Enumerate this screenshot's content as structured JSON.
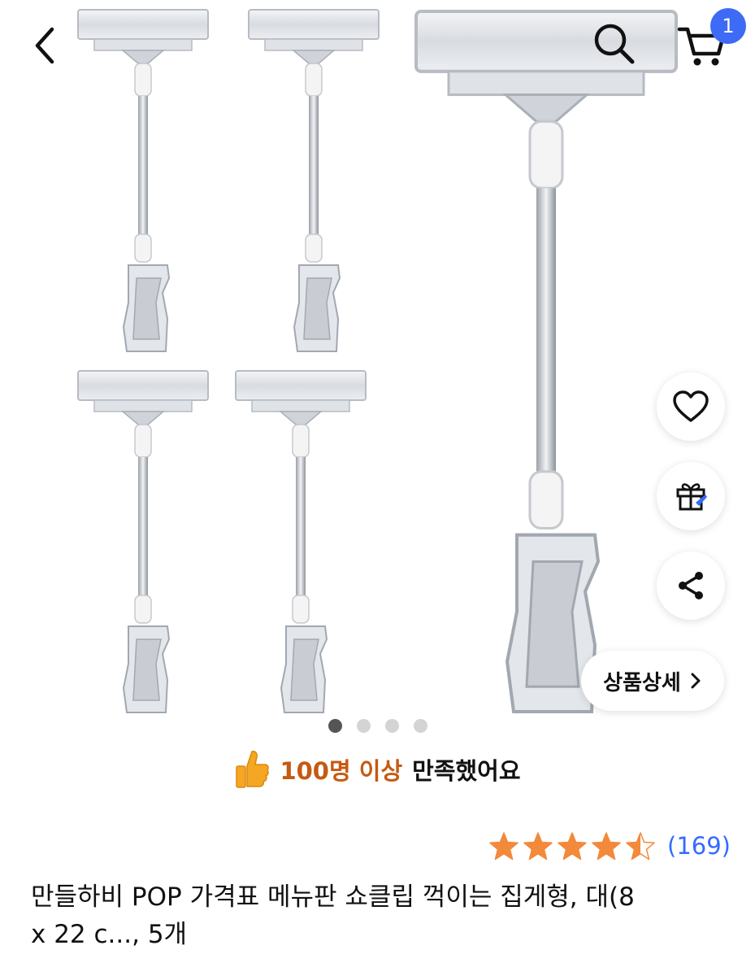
{
  "header": {
    "back_icon": "chevron-left-icon",
    "search_icon": "search-icon",
    "cart_icon": "cart-icon",
    "cart_count": "1"
  },
  "gallery": {
    "total_images": 4,
    "active_index": 0
  },
  "side_actions": {
    "wishlist_icon": "heart-icon",
    "gift_icon": "gift-icon",
    "share_icon": "share-icon",
    "detail_label": "상품상세"
  },
  "satisfaction": {
    "highlight": "100명 이상",
    "suffix": "만족했어요"
  },
  "rating": {
    "stars": 4.5,
    "count_label": "(169)",
    "star_color": "#f3893a"
  },
  "product": {
    "title_line1": "만들하비 POP 가격표 메뉴판 쇼클립 꺽이는 집게형, 대(8",
    "title_line2": "x 22 c..., 5개"
  },
  "colors": {
    "accent": "#346aff",
    "badge": "#3d6bf5",
    "highlight_text": "#c55a11"
  }
}
